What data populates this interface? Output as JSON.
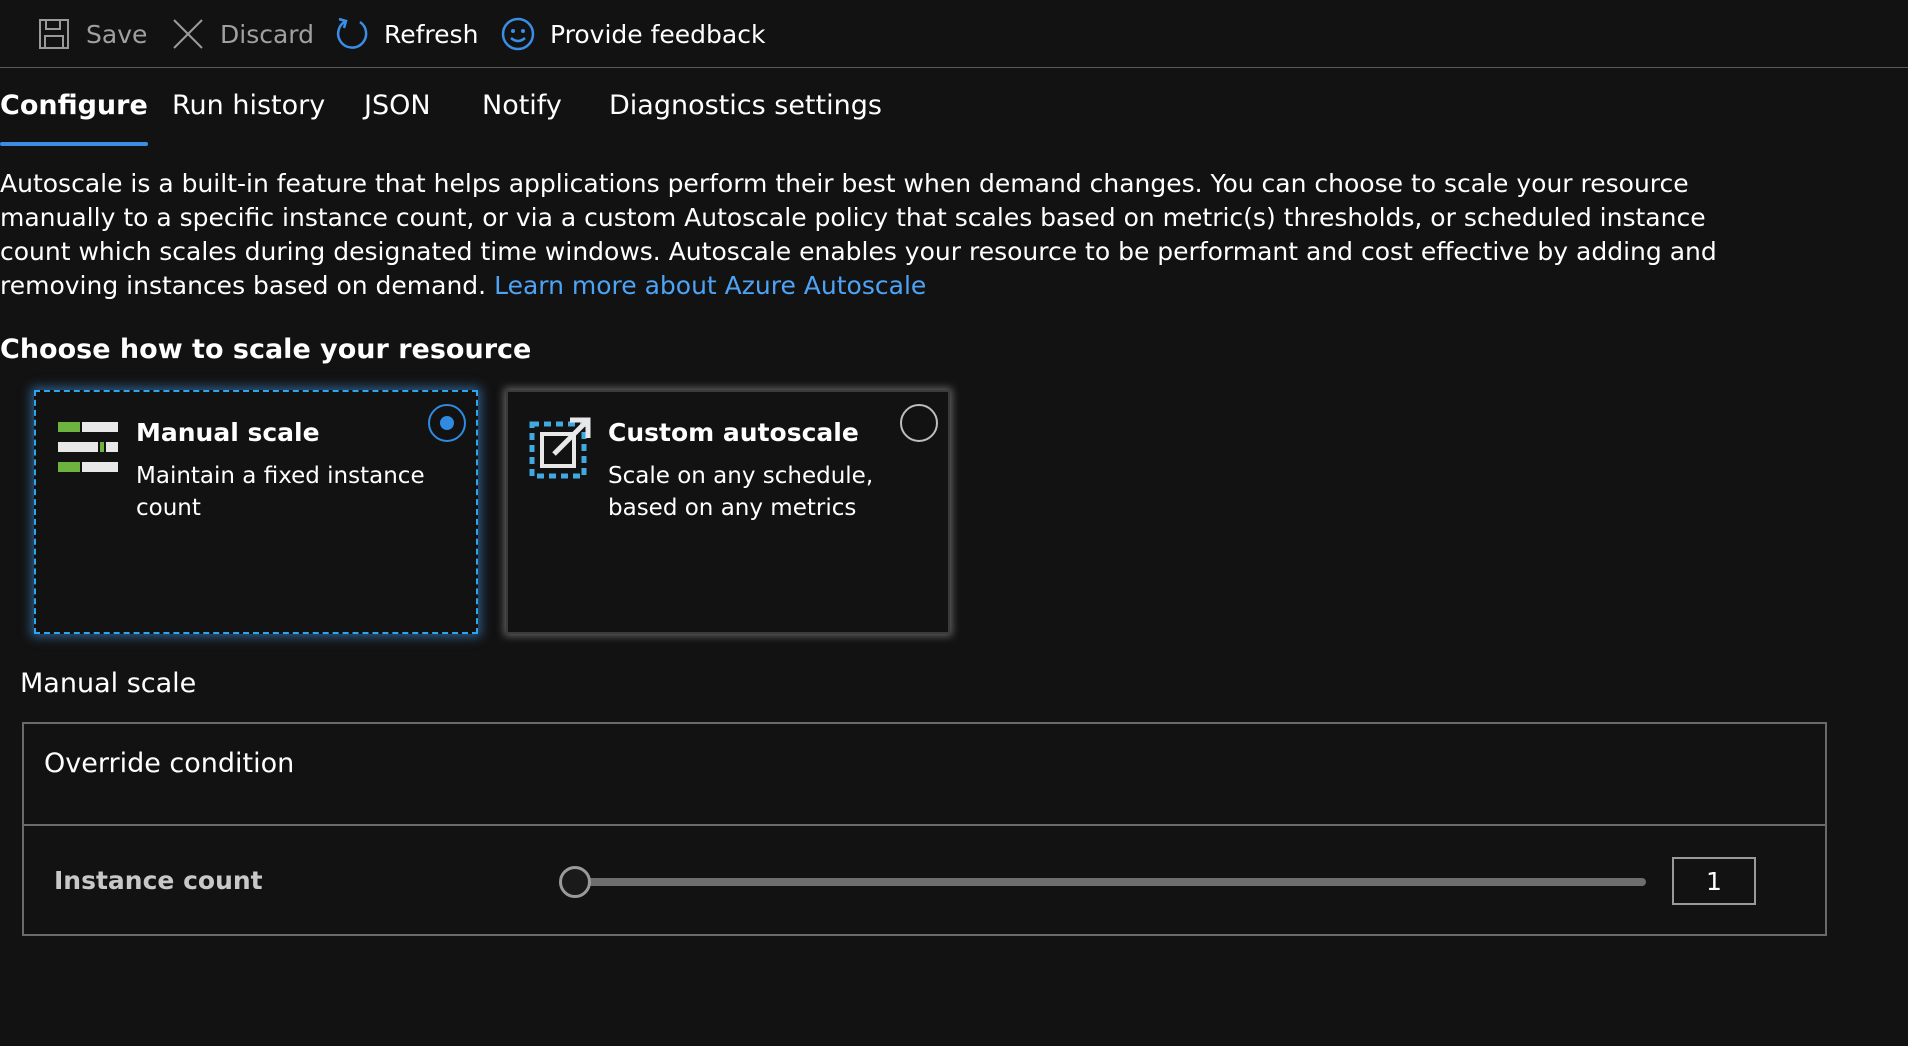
{
  "toolbar": {
    "save_label": "Save",
    "discard_label": "Discard",
    "refresh_label": "Refresh",
    "feedback_label": "Provide feedback"
  },
  "tabs": [
    {
      "label": "Configure",
      "active": true
    },
    {
      "label": "Run history",
      "active": false
    },
    {
      "label": "JSON",
      "active": false
    },
    {
      "label": "Notify",
      "active": false
    },
    {
      "label": "Diagnostics settings",
      "active": false
    }
  ],
  "intro": {
    "text": "Autoscale is a built-in feature that helps applications perform their best when demand changes. You can choose to scale your resource manually to a specific instance count, or via a custom Autoscale policy that scales based on metric(s) thresholds, or scheduled instance count which scales during designated time windows. Autoscale enables your resource to be performant and cost effective by adding and removing instances based on demand.",
    "link_label": "Learn more about Azure Autoscale"
  },
  "scale_choice": {
    "heading": "Choose how to scale your resource",
    "options": [
      {
        "title": "Manual scale",
        "description": "Maintain a fixed instance count",
        "selected": true,
        "icon": "manual-scale-icon"
      },
      {
        "title": "Custom autoscale",
        "description": "Scale on any schedule, based on any metrics",
        "selected": false,
        "icon": "custom-autoscale-icon"
      }
    ]
  },
  "manual_scale": {
    "heading": "Manual scale",
    "override_label": "Override condition",
    "instance_count_label": "Instance count",
    "instance_count_value": "1",
    "slider_fraction": 0
  },
  "colors": {
    "background": "#121212",
    "accent": "#3a8ee6",
    "link": "#4da3f5",
    "manual_icon_green": "#6db33f",
    "autoscale_icon_blue": "#3fa9e0"
  }
}
